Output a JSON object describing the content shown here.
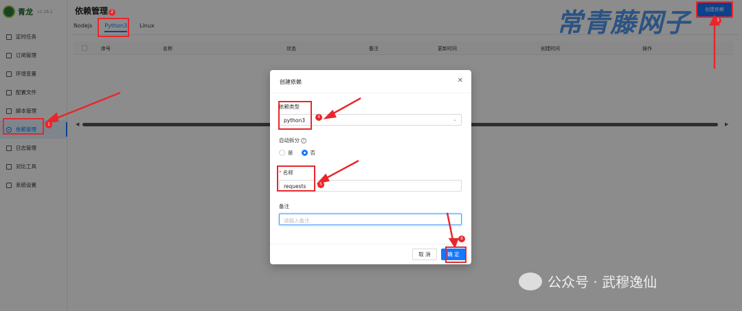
{
  "app": {
    "name": "青龙",
    "version": "v2.18.2"
  },
  "sidebar": {
    "items": [
      {
        "label": "定时任务",
        "icon": "schedule-icon"
      },
      {
        "label": "订阅管理",
        "icon": "subscription-icon"
      },
      {
        "label": "环境变量",
        "icon": "env-icon"
      },
      {
        "label": "配置文件",
        "icon": "config-icon"
      },
      {
        "label": "脚本管理",
        "icon": "script-icon"
      },
      {
        "label": "依赖管理",
        "icon": "dependency-icon",
        "active": true
      },
      {
        "label": "日志管理",
        "icon": "log-icon"
      },
      {
        "label": "对比工具",
        "icon": "diff-icon"
      },
      {
        "label": "系统设置",
        "icon": "settings-icon"
      }
    ]
  },
  "header": {
    "title": "依赖管理",
    "create_button": "创建依赖"
  },
  "tabs": [
    {
      "label": "Nodejs"
    },
    {
      "label": "Python3",
      "active": true
    },
    {
      "label": "Linux"
    }
  ],
  "table": {
    "columns": [
      "序号",
      "名称",
      "状态",
      "备注",
      "更新时间",
      "创建时间",
      "操作"
    ]
  },
  "modal": {
    "title": "创建依赖",
    "type_label": "依赖类型",
    "type_value": "python3",
    "split_label": "自动拆分",
    "split_yes": "是",
    "split_no": "否",
    "name_label": "名称",
    "name_value": "requests",
    "remark_label": "备注",
    "remark_placeholder": "请输入备注",
    "cancel": "取 消",
    "ok": "确 定"
  },
  "annotations": [
    "1",
    "2",
    "3",
    "4",
    "5",
    "6"
  ],
  "watermarks": {
    "top": "常青藤网子",
    "bottom": "公众号 · 武穆逸仙"
  },
  "colors": {
    "accent": "#1677ff",
    "annotation": "#e8262b"
  }
}
